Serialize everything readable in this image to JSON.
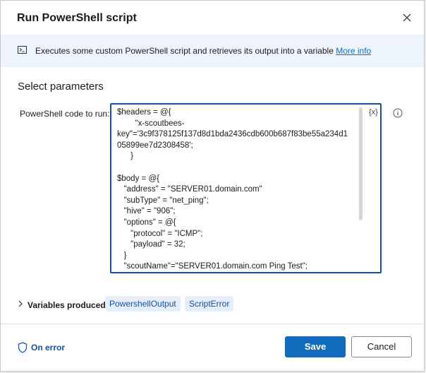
{
  "dialog": {
    "title": "Run PowerShell script",
    "close_icon": "close-icon"
  },
  "banner": {
    "icon": "terminal-icon",
    "text": "Executes some custom PowerShell script and retrieves its output into a variable ",
    "link": "More info"
  },
  "section": {
    "title": "Select parameters"
  },
  "param": {
    "label": "PowerShell code to run:",
    "fx": "{x}",
    "info_icon": "info-icon",
    "code_lines": [
      "$headers = @{",
      "        \"x-scoutbees-",
      "key\"='3c9f378125f137d8d1bda2436cdb600b687f83be55a234d1",
      "05899ee7d2308458';",
      "      }",
      "",
      "$body = @{",
      "   \"address\" = \"SERVER01.domain.com\"",
      "   \"subType\" = \"net_ping\";",
      "   \"hive\" = \"906\";",
      "   \"options\" = @{",
      "      \"protocol\" = \"ICMP\";",
      "      \"payload\" = 32;",
      "   }",
      "   \"scoutName\"=\"SERVER01.domain.com Ping Test\";"
    ]
  },
  "variables": {
    "label": "Variables produced",
    "chips": [
      "PowershellOutput",
      "ScriptError"
    ]
  },
  "footer": {
    "on_error": "On error",
    "save": "Save",
    "cancel": "Cancel"
  },
  "colors": {
    "accent": "#0f6cbd",
    "banner_bg": "#eef4fc",
    "chip_bg": "#e6eefb",
    "focus_border": "#1a4fa0"
  }
}
